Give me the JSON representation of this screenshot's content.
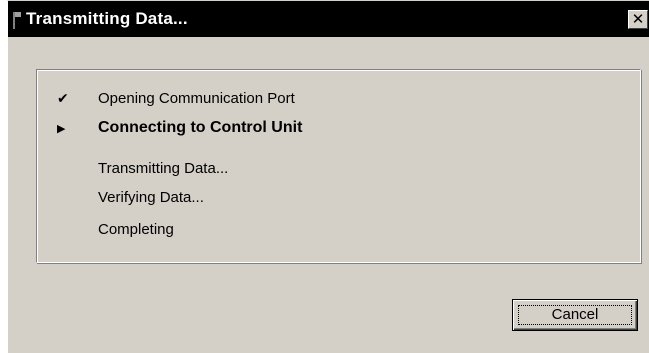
{
  "window": {
    "title": "Transmitting Data...",
    "close_label": "✕"
  },
  "steps": [
    {
      "label": "Opening Communication Port",
      "status": "done",
      "marker": "✔"
    },
    {
      "label": "Connecting to Control Unit",
      "status": "active",
      "marker": "▶"
    },
    {
      "label": "Transmitting Data...",
      "status": "pending",
      "marker": ""
    },
    {
      "label": "Verifying Data...",
      "status": "pending",
      "marker": ""
    },
    {
      "label": "Completing",
      "status": "pending",
      "marker": ""
    }
  ],
  "buttons": {
    "cancel_label": "Cancel"
  },
  "colors": {
    "titlebar": "#000000",
    "title_text": "#ffffff",
    "face": "#d4d0c8"
  }
}
